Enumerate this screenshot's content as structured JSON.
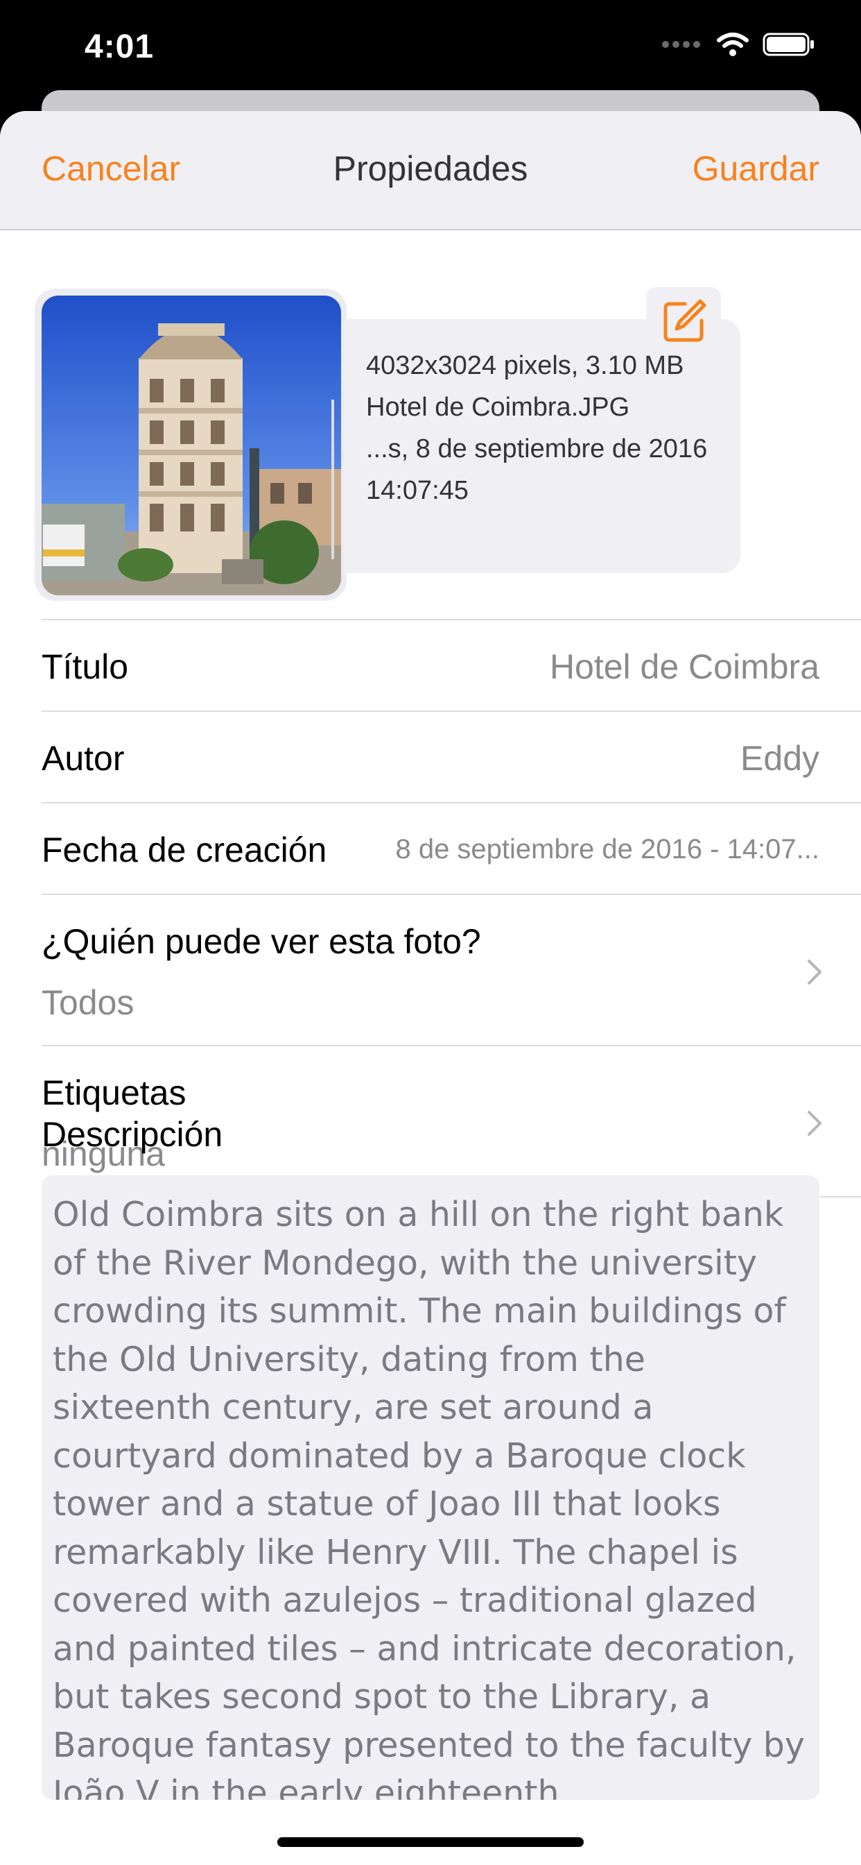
{
  "status_bar": {
    "time": "4:01",
    "icons": [
      "signal-icon",
      "wifi-icon",
      "battery-icon"
    ]
  },
  "nav": {
    "cancel": "Cancelar",
    "title": "Propiedades",
    "save": "Guardar"
  },
  "photo": {
    "dimensions_size": "4032x3024 pixels, 3.10 MB",
    "filename": "Hotel de Coimbra.JPG",
    "date_line": "...s, 8 de septiembre de 2016",
    "time_line": "14:07:45",
    "edit_icon": "edit-icon"
  },
  "fields": {
    "title": {
      "label": "Título",
      "value": "Hotel de Coimbra"
    },
    "author": {
      "label": "Autor",
      "value": "Eddy"
    },
    "created": {
      "label": "Fecha de creación",
      "value": "8 de septiembre de 2016 - 14:07..."
    },
    "visibility": {
      "label": "¿Quién puede ver esta foto?",
      "value": "Todos"
    },
    "tags": {
      "label": "Etiquetas",
      "value": "ninguna"
    }
  },
  "description": {
    "label": "Descripción",
    "text": "Old Coimbra sits on a hill on the right bank of the River Mondego, with the university crowding its summit. The main buildings of the Old University, dating from the sixteenth century, are set around a courtyard dominated by a Baroque clock tower and a statue of Joao III that looks remarkably like Henry VIII. The chapel is covered with azulejos – traditional glazed and painted tiles – and intricate decoration, but takes second spot to the Library, a Baroque fantasy presented to the faculty by João V in the early eighteenth"
  },
  "colors": {
    "accent": "#f7821c",
    "secondary_text": "#8a8a8e",
    "grouped_background": "#efeff4"
  }
}
